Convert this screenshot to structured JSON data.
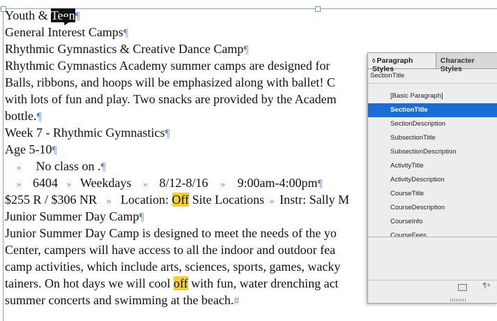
{
  "document": {
    "lines": [
      {
        "type": "heading-sel",
        "before": "Youth & ",
        "selected": "Teen",
        "after": ""
      },
      {
        "type": "plain",
        "text": "General Interest Camps"
      },
      {
        "type": "plain",
        "text": "Rhythmic Gymnastics & Creative Dance Camp"
      },
      {
        "type": "cont",
        "text": "Rhythmic Gymnastics Academy summer camps are designed for"
      },
      {
        "type": "cont",
        "text": "Balls, ribbons, and hoops will be emphasized along with ballet!  C"
      },
      {
        "type": "cont",
        "text": "with lots of fun and play.  Two snacks are provided by the Academ"
      },
      {
        "type": "plain",
        "text": "bottle."
      },
      {
        "type": "plain",
        "text": "Week 7 - Rhythmic Gymnastics"
      },
      {
        "type": "plain",
        "text": "Age 5-10"
      },
      {
        "type": "noclass",
        "text": "No class on ."
      },
      {
        "type": "session",
        "code": "6404",
        "days": "Weekdays",
        "dates": "8/12-8/16",
        "time": "9:00am-4:00pm"
      },
      {
        "type": "fee",
        "fee": "$255 R / $306 NR",
        "loc_before": "Location: ",
        "loc_hl": "Off",
        "loc_after": " Site Locations",
        "instr": "Instr: Sally M"
      },
      {
        "type": "plain",
        "text": "Junior Summer Day Camp"
      },
      {
        "type": "cont",
        "text": "Junior Summer Day Camp is designed to meet the needs of the yo"
      },
      {
        "type": "cont",
        "text": "Center, campers will have access to all the indoor and outdoor fea"
      },
      {
        "type": "cont",
        "text": "camp activities, which include arts, sciences, sports, games, wacky"
      },
      {
        "type": "hotdays",
        "before": "tainers. On hot days we will cool ",
        "hl": "off",
        "after": " with fun, water drenching act"
      },
      {
        "type": "end",
        "text": "summer concerts and swimming at the beach."
      }
    ]
  },
  "panel": {
    "tab_paragraph": "Paragraph Styles",
    "tab_character": "Character Styles",
    "current_style": "SectionTitle",
    "styles": [
      "[Basic Paragraph]",
      "SectionTitle",
      "SectionDescription",
      "SubsectionTitle",
      "SubsectionDescription",
      "ActivityTitle",
      "ActivityDescription",
      "CourseTitle",
      "CourseDescription",
      "CourseInfo",
      "CourseFees"
    ],
    "selected_index": 1,
    "new_style_glyph": "¶+",
    "colors": {
      "selection": "#1b6dd6",
      "highlight": "#f5cf2e",
      "invisibles": "#5f8fd6"
    }
  },
  "icons": [
    "text-cursor-icon",
    "panel-collapse-icon",
    "new-group-folder-icon",
    "new-style-icon"
  ]
}
